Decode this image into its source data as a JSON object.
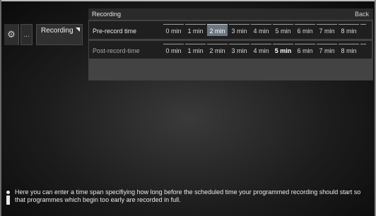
{
  "sidebar": {
    "gear_icon": "gear-icon",
    "more_label": "...",
    "menu_label": "Recording"
  },
  "panel": {
    "title": "Recording",
    "back_label": "Back",
    "rows": [
      {
        "label": "Pre-record time",
        "options": [
          "0 min",
          "1 min",
          "2 min",
          "3 min",
          "4 min",
          "5 min",
          "6 min",
          "7 min",
          "8 min"
        ],
        "selected": "2 min"
      },
      {
        "label": "Post-record-time",
        "options": [
          "0 min",
          "1 min",
          "2 min",
          "3 min",
          "4 min",
          "5 min",
          "6 min",
          "7 min",
          "8 min"
        ],
        "selected": "5 min"
      }
    ]
  },
  "info": {
    "icon": "info-icon",
    "text": "Here you can enter a time span specifiying how long before the scheduled time your programmed recording should start so that programmes which begin too early are recorded in full."
  },
  "colors": {
    "selected_focus": "#6d7781",
    "panel_bg": "#434343",
    "row_bg": "#1f1f1f"
  }
}
